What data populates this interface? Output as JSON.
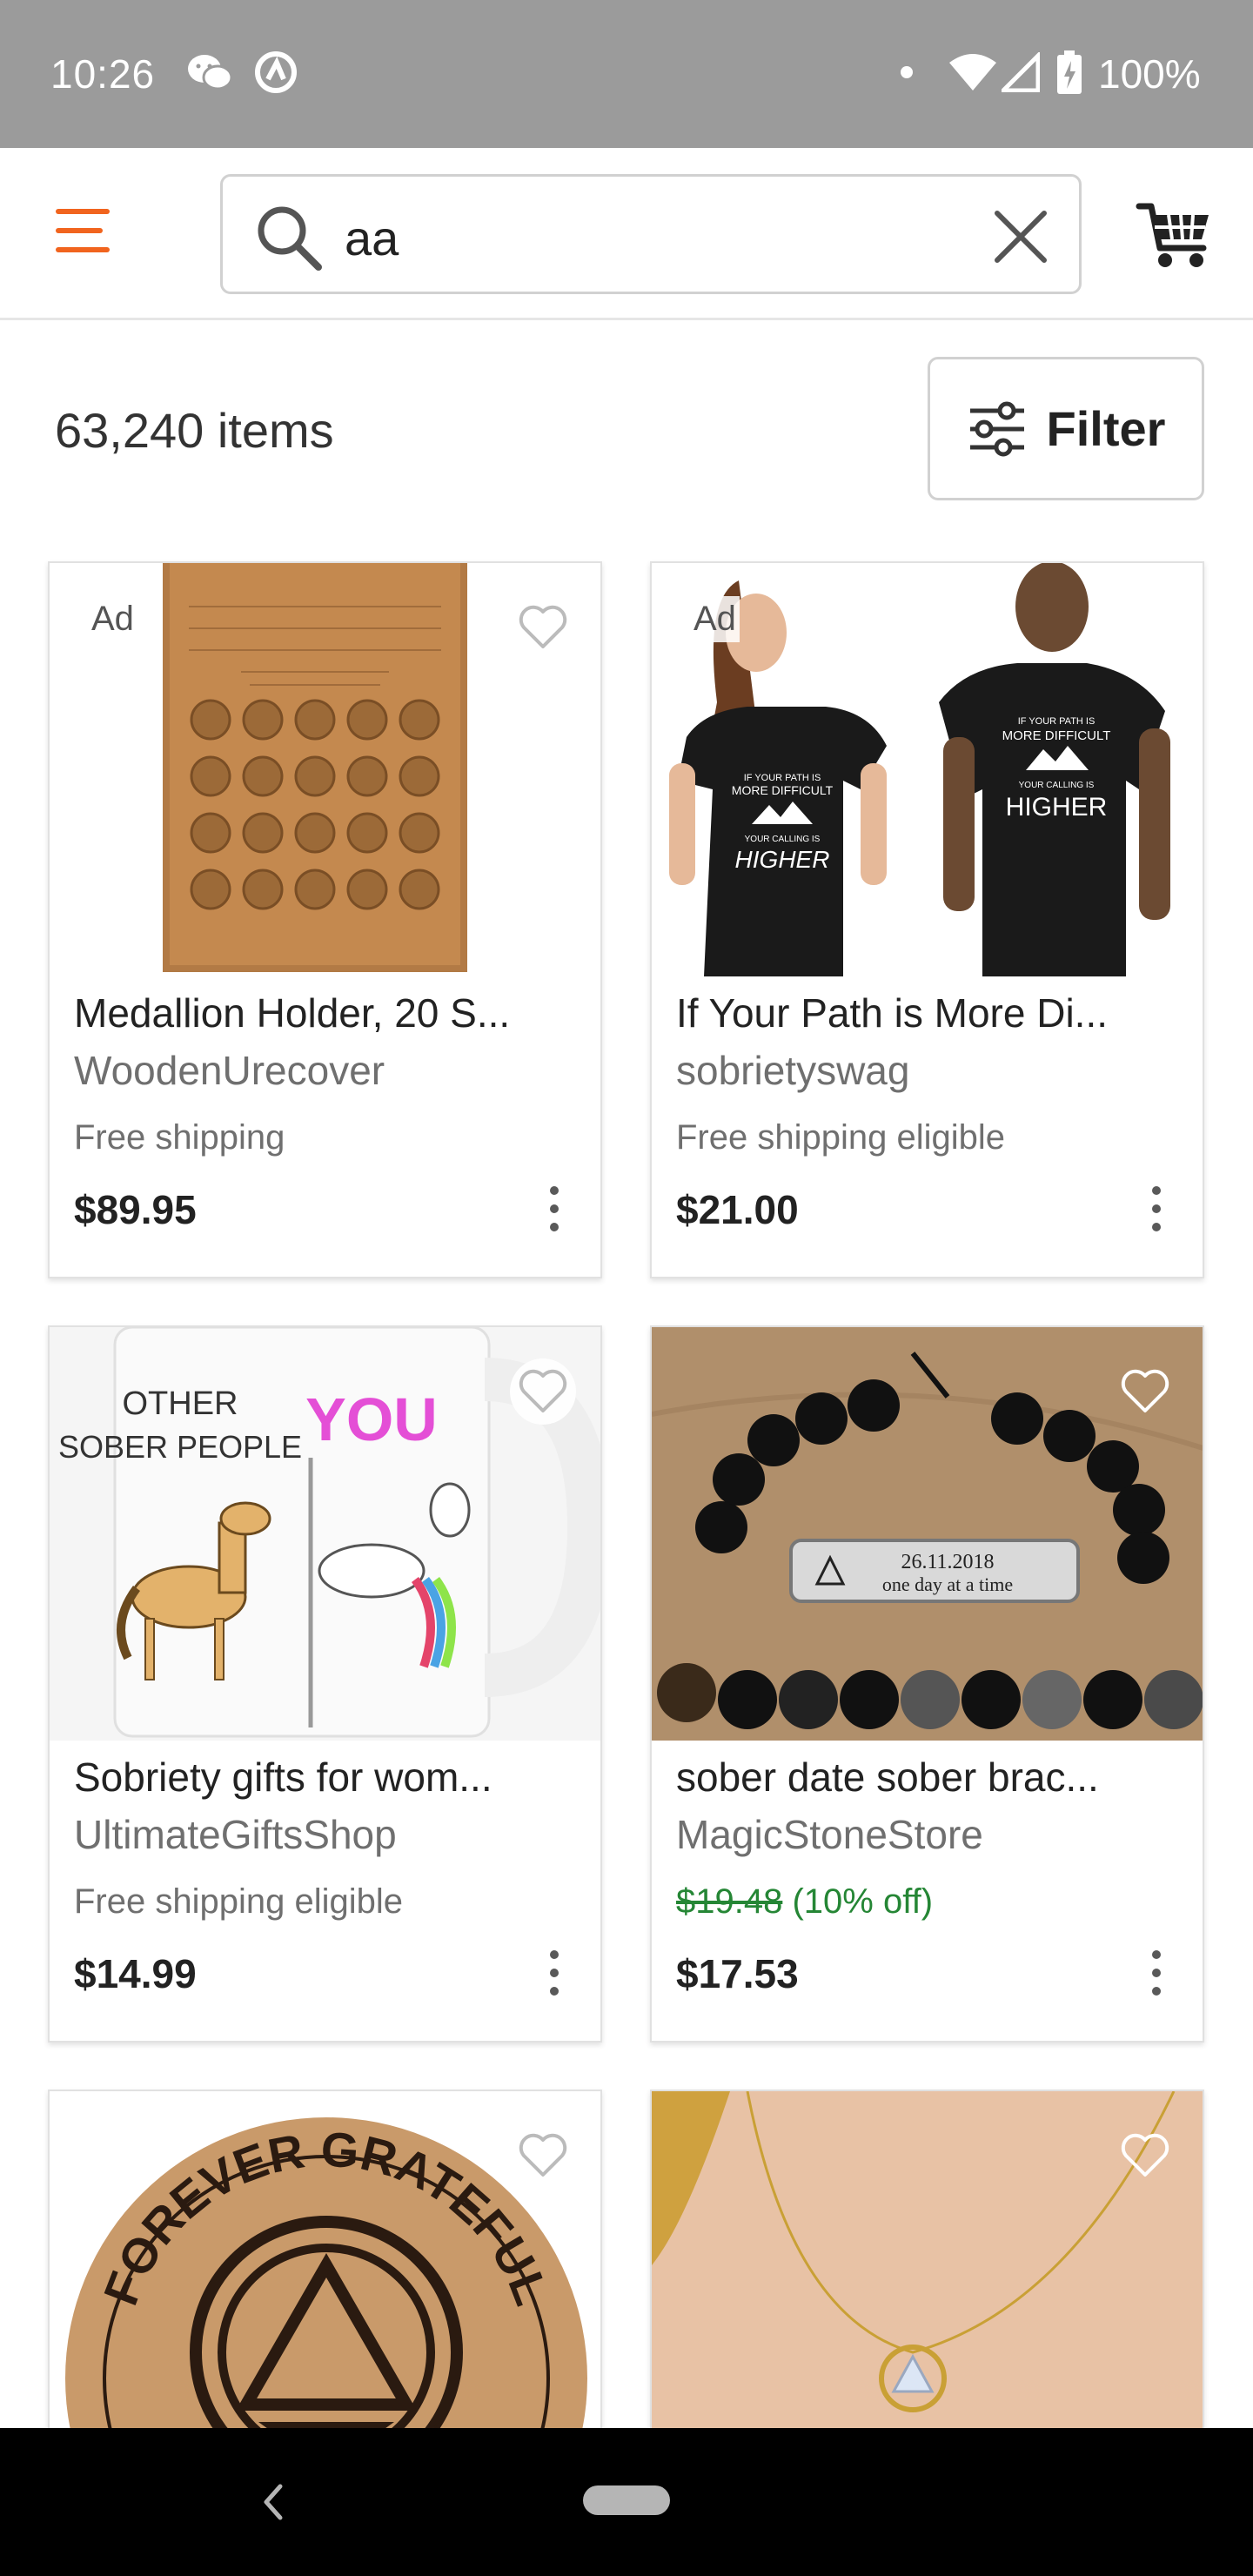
{
  "status_bar": {
    "time": "10:26",
    "battery_pct": "100%",
    "icons": [
      "wechat-icon",
      "app-icon",
      "dot-icon",
      "wifi-icon",
      "signal-icon",
      "battery-icon"
    ]
  },
  "header": {
    "search_value": "aa",
    "icons": [
      "menu-icon",
      "search-icon",
      "clear-icon",
      "cart-icon"
    ],
    "accent_color": "#f1641e"
  },
  "results": {
    "count": "63,240 items",
    "filter_label": "Filter"
  },
  "products": [
    {
      "ad": "Ad",
      "title": "Medallion Holder, 20 S...",
      "shop": "WoodenUrecover",
      "shipping": "Free shipping",
      "price": "$89.95"
    },
    {
      "ad": "Ad",
      "title": "If Your Path is More Di...",
      "shop": "sobrietyswag",
      "shipping": "Free shipping eligible",
      "price": "$21.00",
      "image_text": {
        "line1": "IF YOUR PATH IS",
        "line2": "MORE DIFFICULT",
        "line3": "YOUR CALLING IS",
        "line4": "HIGHER"
      }
    },
    {
      "title": "Sobriety gifts for wom...",
      "shop": "UltimateGiftsShop",
      "shipping": "Free shipping eligible",
      "price": "$14.99",
      "image_text": {
        "line1": "OTHER",
        "line2": "SOBER PEOPLE",
        "line3": "YOU"
      }
    },
    {
      "title": "sober date sober brac...",
      "shop": "MagicStoneStore",
      "original_price": "$19.48",
      "discount": "(10% off)",
      "price": "$17.53",
      "image_text": {
        "line1": "26.11.2018",
        "line2": "one day at a time"
      }
    },
    {
      "image_text": {
        "line1": "FOREVER GRATEFUL"
      }
    },
    {}
  ]
}
